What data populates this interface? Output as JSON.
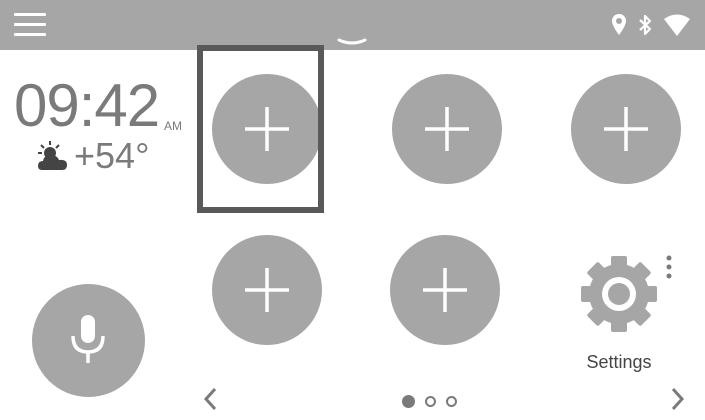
{
  "status_bar": {
    "icons": [
      "menu-icon",
      "chevron-down-icon",
      "location-pin-icon",
      "bluetooth-icon",
      "wifi-icon"
    ]
  },
  "clock": {
    "time": "09:42",
    "ampm": "AM"
  },
  "weather": {
    "icon": "partly-cloudy-icon",
    "temperature": "+54°"
  },
  "tiles": [
    {
      "icon": "plus-icon",
      "selected": true
    },
    {
      "icon": "plus-icon",
      "selected": false
    },
    {
      "icon": "plus-icon",
      "selected": false
    },
    {
      "icon": "plus-icon",
      "selected": false
    },
    {
      "icon": "plus-icon",
      "selected": false
    }
  ],
  "voice_button": {
    "icon": "microphone-icon"
  },
  "settings": {
    "label": "Settings",
    "icon": "gear-icon"
  },
  "pagination": {
    "pages": 3,
    "current": 1
  },
  "colors": {
    "accent_gray": "#a6a6a6",
    "text_gray": "#7a7a7a",
    "selection_border": "#595959"
  }
}
